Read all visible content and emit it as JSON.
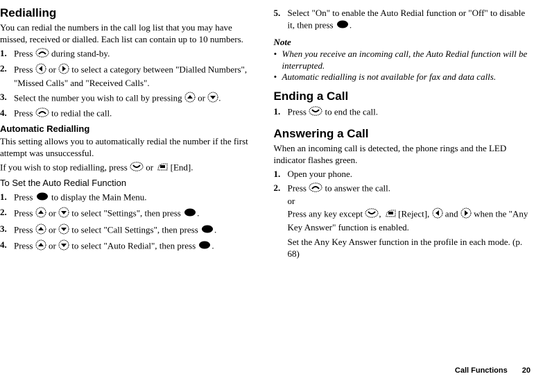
{
  "left": {
    "h_redialling": "Redialling",
    "redial_intro": "You can redial the numbers in the call log list that you may have missed, received or dialled. Each list can contain up to 10 numbers.",
    "steps_redial": [
      "Press  during stand-by.",
      "Press  or  to select a category between \"Dialled Numbers\", \"Missed Calls\" and \"Received Calls\".",
      "Select the number you wish to call by pressing  or  .",
      "Press  to redial the call."
    ],
    "h_auto": "Automatic Redialling",
    "auto_p1": "This setting allows you to automatically redial the number if the first attempt was unsuccessful.",
    "auto_p2_a": "If you wish to stop redialling, press ",
    "auto_p2_b": " or ",
    "auto_p2_c": " [End].",
    "h_setauto": "To Set the Auto Redial Function",
    "steps_setauto": [
      "Press  to display the Main Menu.",
      "Press  or  to select \"Settings\", then press  .",
      "Press  or  to select \"Call Settings\", then press  .",
      "Press  or  to select \"Auto Redial\", then press  ."
    ]
  },
  "right": {
    "step5": "Select \"On\" to enable the Auto Redial function or \"Off\" to disable it, then press  .",
    "note_h": "Note",
    "notes": [
      "When you receive an incoming call, the Auto Redial function will be interrupted.",
      "Automatic redialling is not available for fax and data calls."
    ],
    "h_end": "Ending a Call",
    "end_step": "Press  to end the call.",
    "h_answer": "Answering a Call",
    "answer_p": "When an incoming call is detected, the phone rings and the LED indicator flashes green.",
    "ans_step1": "Open your phone.",
    "ans_step2": "Press  to answer the call.",
    "ans_or": "or",
    "ans_p2a": "Press any key except ",
    "ans_p2b": ", ",
    "ans_p2c": " [Reject], ",
    "ans_p2d": " and ",
    "ans_p2e": " when the \"Any Key Answer\" function is enabled.",
    "ans_p3": "Set the Any Key Answer function in the profile in each mode. (p. 68)"
  },
  "footer": {
    "label": "Call Functions",
    "page": "20"
  }
}
